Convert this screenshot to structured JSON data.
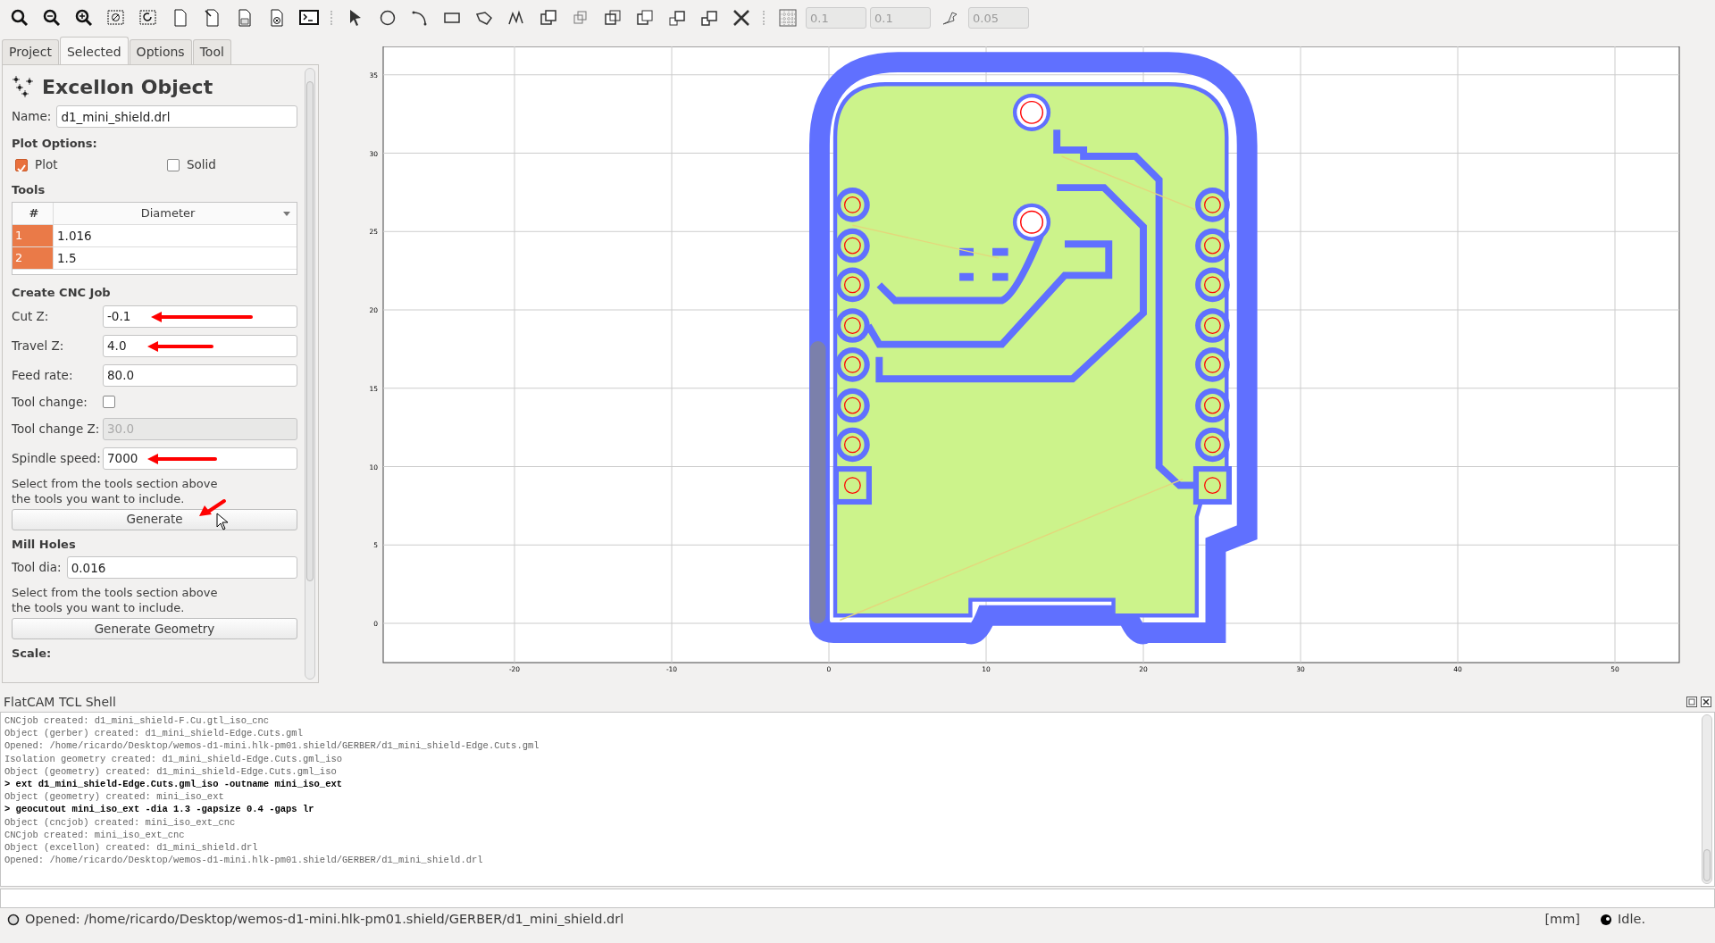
{
  "toolbar": {
    "fields": [
      {
        "value": "0.1",
        "disabled": true
      },
      {
        "value": "0.1",
        "disabled": true
      },
      {
        "value": "0.05",
        "disabled": true
      }
    ]
  },
  "tabs": [
    {
      "label": "Project",
      "selected": false
    },
    {
      "label": "Selected",
      "selected": true
    },
    {
      "label": "Options",
      "selected": false
    },
    {
      "label": "Tool",
      "selected": false
    }
  ],
  "panel": {
    "title": "Excellon Object",
    "name_label": "Name:",
    "name_value": "d1_mini_shield.drl",
    "plot_options_heading": "Plot Options:",
    "checkboxes": [
      {
        "label": "Plot",
        "checked": true
      },
      {
        "label": "Solid",
        "checked": false
      }
    ],
    "tools_heading": "Tools",
    "tools_table": {
      "columns": [
        "#",
        "Diameter"
      ],
      "rows": [
        {
          "number": "1",
          "diameter": "1.016"
        },
        {
          "number": "2",
          "diameter": "1.5"
        }
      ]
    },
    "cnc_heading": "Create CNC Job",
    "cnc_fields": [
      {
        "kind": "text",
        "label": "Cut Z:",
        "value": "-0.1",
        "disabled": false,
        "annotated": true
      },
      {
        "kind": "text",
        "label": "Travel Z:",
        "value": "4.0",
        "disabled": false,
        "annotated": true
      },
      {
        "kind": "text",
        "label": "Feed rate:",
        "value": "80.0",
        "disabled": false,
        "annotated": false
      },
      {
        "kind": "checkbox",
        "label": "Tool change:",
        "checked": false
      },
      {
        "kind": "text",
        "label": "Tool change Z:",
        "value": "30.0",
        "disabled": true,
        "annotated": false
      },
      {
        "kind": "text",
        "label": "Spindle speed:",
        "value": "7000",
        "disabled": false,
        "annotated": true
      }
    ],
    "cnc_hint": "Select from the tools section above\nthe tools you want to include.",
    "generate_button": {
      "label": "Generate",
      "annotated": true
    },
    "mill_heading": "Mill Holes",
    "mill_field": {
      "label": "Tool dia:",
      "value": "0.016"
    },
    "mill_hint": "Select from the tools section above\nthe tools you want to include.",
    "mill_button": "Generate Geometry",
    "scale_heading": "Scale:"
  },
  "plot": {
    "xticks": [
      "-20",
      "-10",
      "0",
      "10",
      "20",
      "30",
      "40",
      "50"
    ],
    "yticks": [
      "35",
      "30",
      "25",
      "20",
      "15",
      "10",
      "5",
      "0"
    ]
  },
  "shell": {
    "title": "FlatCAM TCL Shell",
    "lines": [
      {
        "kind": "output",
        "text": "CNCjob created: d1_mini_shield-F.Cu.gtl_iso_cnc"
      },
      {
        "kind": "output",
        "text": "Object (gerber) created: d1_mini_shield-Edge.Cuts.gml"
      },
      {
        "kind": "output",
        "text": "Opened: /home/ricardo/Desktop/wemos-d1-mini.hlk-pm01.shield/GERBER/d1_mini_shield-Edge.Cuts.gml"
      },
      {
        "kind": "output",
        "text": "Isolation geometry created: d1_mini_shield-Edge.Cuts.gml_iso"
      },
      {
        "kind": "output",
        "text": "Object (geometry) created: d1_mini_shield-Edge.Cuts.gml_iso"
      },
      {
        "kind": "command",
        "text": "> ext d1_mini_shield-Edge.Cuts.gml_iso -outname mini_iso_ext"
      },
      {
        "kind": "output",
        "text": "Object (geometry) created: mini_iso_ext"
      },
      {
        "kind": "command",
        "text": "> geocutout mini_iso_ext -dia 1.3 -gapsize 0.4 -gaps lr"
      },
      {
        "kind": "output",
        "text": "Object (cncjob) created: mini_iso_ext_cnc"
      },
      {
        "kind": "output",
        "text": "CNCjob created: mini_iso_ext_cnc"
      },
      {
        "kind": "output",
        "text": "Object (excellon) created: d1_mini_shield.drl"
      },
      {
        "kind": "output",
        "text": "Opened: /home/ricardo/Desktop/wemos-d1-mini.hlk-pm01.shield/GERBER/d1_mini_shield.drl"
      }
    ]
  },
  "status_bar": {
    "message": "Opened: /home/ricardo/Desktop/wemos-d1-mini.hlk-pm01.shield/GERBER/d1_mini_shield.drl",
    "units": "[mm]",
    "state": "Idle."
  }
}
